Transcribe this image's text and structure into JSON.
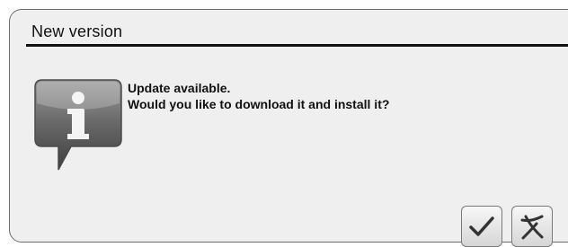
{
  "dialog": {
    "title": "New version",
    "message_line1": "Update available.",
    "message_line2": "Would you like to download it and install it?",
    "icon": "info-speech-bubble-icon",
    "buttons": [
      {
        "name": "confirm",
        "icon": "checkmark-icon"
      },
      {
        "name": "cancel",
        "icon": "cross-icon"
      }
    ]
  }
}
